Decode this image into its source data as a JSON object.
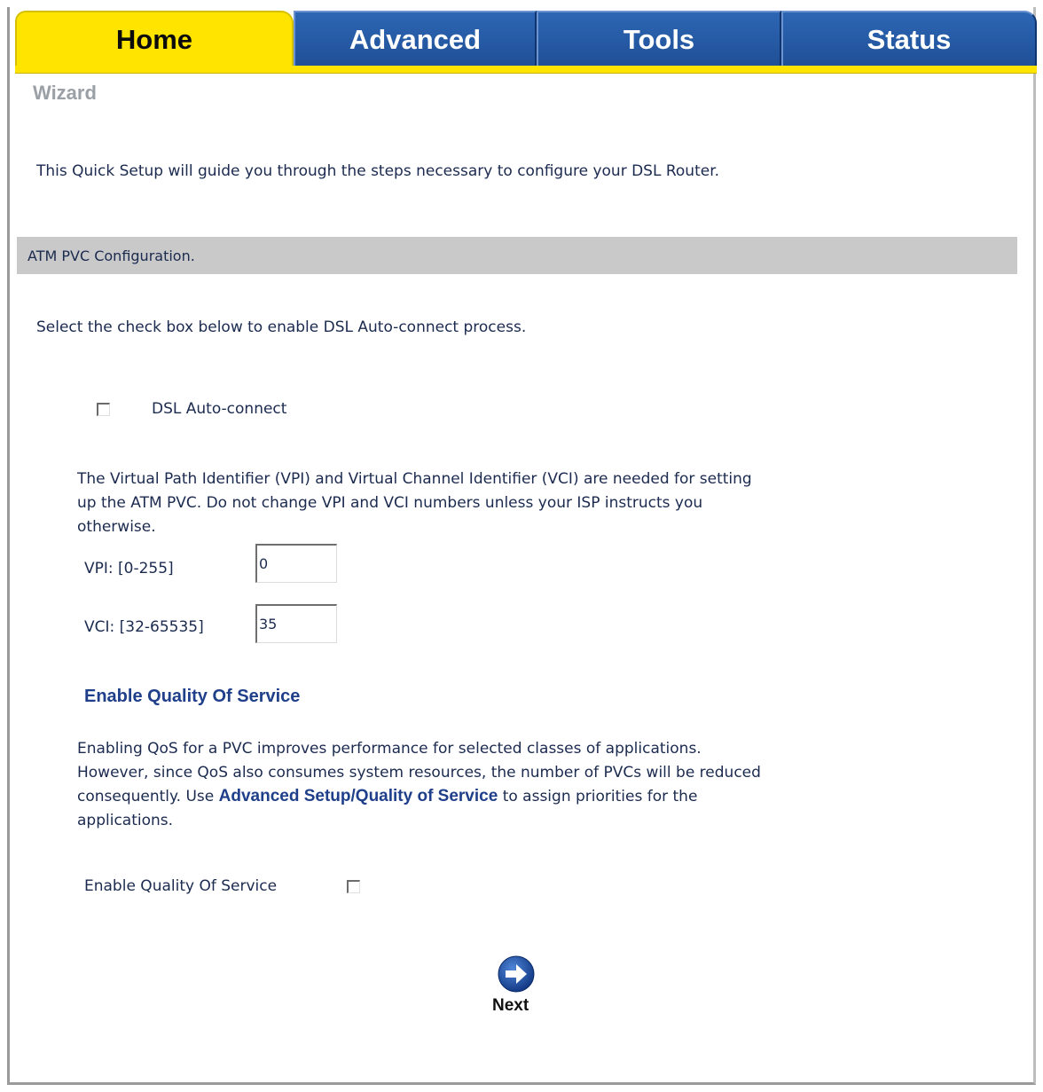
{
  "tabs": [
    {
      "label": "Home",
      "active": true
    },
    {
      "label": "Advanced",
      "active": false
    },
    {
      "label": "Tools",
      "active": false
    },
    {
      "label": "Status",
      "active": false
    }
  ],
  "page_title": "Wizard",
  "intro_text": "This Quick Setup will guide you through the steps necessary to configure your DSL Router.",
  "section_title": "ATM PVC Configuration.",
  "autoconnect": {
    "instruction": "Select the check box below to enable DSL Auto-connect process.",
    "label": "DSL Auto-connect",
    "checked": false
  },
  "vpi_vci": {
    "description": [
      "The Virtual Path Identifier (VPI) and Virtual Channel Identifier (VCI) are needed for setting",
      "up the ATM PVC. Do not change VPI and VCI numbers unless your ISP instructs you",
      "otherwise."
    ],
    "vpi_label": "VPI: [0-255]",
    "vpi_value": "0",
    "vci_label": "VCI: [32-65535]",
    "vci_value": "35"
  },
  "qos": {
    "heading": "Enable Quality Of Service",
    "desc_line1": "Enabling QoS for a PVC improves performance for selected classes of applications.",
    "desc_line2": "However, since QoS also consumes system resources, the number of PVCs will be reduced",
    "desc_line3_pre": "consequently. Use ",
    "desc_line3_link": "Advanced Setup/Quality of Service",
    "desc_line3_post": " to assign priorities for the",
    "desc_line4": "applications.",
    "checkbox_label": "Enable Quality Of Service",
    "checked": false
  },
  "next_button": {
    "label": "Next",
    "icon": "arrow-right-circle-icon",
    "color": "#1f4fa8"
  },
  "colors": {
    "active_tab": "#ffe400",
    "inactive_tab": "#2459a6",
    "section_bar": "#c9c9c9",
    "heading_blue": "#1f3f8a"
  }
}
